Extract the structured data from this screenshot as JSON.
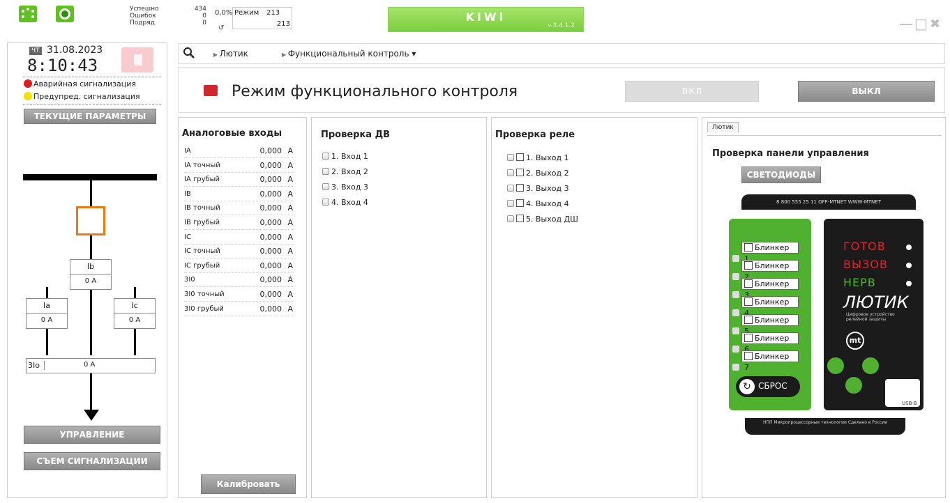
{
  "topbar": {
    "stats": {
      "ok_label": "Успешно",
      "ok_val": "434",
      "err_label": "Ошибок",
      "err_val": "0",
      "row_label": "Подряд",
      "row_val": "0",
      "percent": "0,0%",
      "mode_label": "Режим",
      "mode_val1": "213",
      "mode_val2": "213",
      "refresh_glyph": "↺"
    },
    "brand": "KIWI",
    "version": "v.3.4.1.2",
    "window_controls": {
      "min": "—",
      "max": "□",
      "close": "✖"
    }
  },
  "left": {
    "day": "ЧТ",
    "date": "31.08.2023",
    "time": "8:10:43",
    "alarms": [
      {
        "label": "Аварийная сигнализация",
        "color": "#e21b1b"
      },
      {
        "label": "Предупред. сигнализация",
        "color": "#f5e100"
      }
    ],
    "current_params": "ТЕКУЩИЕ ПАРАМЕТРЫ",
    "diagram": {
      "ib": "Ib",
      "ib_val": "0 A",
      "ia": "Ia",
      "ia_val": "0 A",
      "ic": "Ic",
      "ic_val": "0 A",
      "i3o": "3Io",
      "i3o_val": "0 A"
    },
    "control_btn": "УПРАВЛЕНИЕ",
    "reset_btn": "СЪЕМ СИГНАЛИЗАЦИИ"
  },
  "nav": {
    "crumb1": "Лютик",
    "crumb2": "Функциональный контроль ▾"
  },
  "header": {
    "title": "Режим функционального контроля",
    "on": "ВКЛ",
    "off": "ВЫКЛ",
    "status_color": "#d0282e"
  },
  "analog": {
    "title": "Аналоговые входы",
    "rows": [
      {
        "name": "IA",
        "value": "0,000",
        "unit": "A"
      },
      {
        "name": "IA точный",
        "value": "0,000",
        "unit": "A"
      },
      {
        "name": "IA грубый",
        "value": "0,000",
        "unit": "A"
      },
      {
        "name": "IB",
        "value": "0,000",
        "unit": "A"
      },
      {
        "name": "IB точный",
        "value": "0,000",
        "unit": "A"
      },
      {
        "name": "IB грубый",
        "value": "0,000",
        "unit": "A"
      },
      {
        "name": "IC",
        "value": "0,000",
        "unit": "A"
      },
      {
        "name": "IC точный",
        "value": "0,000",
        "unit": "A"
      },
      {
        "name": "IC грубый",
        "value": "0,000",
        "unit": "A"
      },
      {
        "name": "3I0",
        "value": "0,000",
        "unit": "A"
      },
      {
        "name": "3I0 точный",
        "value": "0,000",
        "unit": "A"
      },
      {
        "name": "3I0 грубый",
        "value": "0,000",
        "unit": "A"
      }
    ],
    "calibrate": "Калибровать"
  },
  "dv": {
    "title": "Проверка ДВ",
    "items": [
      "1. Вход 1",
      "2. Вход 2",
      "3. Вход 3",
      "4. Вход 4"
    ]
  },
  "relay": {
    "title": "Проверка реле",
    "items": [
      "1. Выход 1",
      "2. Выход 2",
      "3. Выход 3",
      "4. Выход 4",
      "5. Выход ДШ"
    ]
  },
  "panel": {
    "tab": "Лютик",
    "title": "Проверка панели управления",
    "leds_btn": "СВЕТОДИОДЫ",
    "contact_strip": "8 800 555 25 11   OFF-MTNET   WWW-MTNET",
    "blinkers": [
      "Блинкер 1",
      "Блинкер 2",
      "Блинкер 3",
      "Блинкер 4",
      "Блинкер 5",
      "Блинкер 6",
      "Блинкер 7"
    ],
    "reset": "СБРОС",
    "led_gotov": "ГОТОВ",
    "led_vyzov": "ВЫЗОВ",
    "led_nerv": "НЕРВ",
    "brand": "ЛЮТИК",
    "brand_sub": "Цифровое устройство релейной защиты",
    "usb": "USB-B",
    "bottom_strip": "НПП Микропроцессорные технологии Сделано в России"
  }
}
